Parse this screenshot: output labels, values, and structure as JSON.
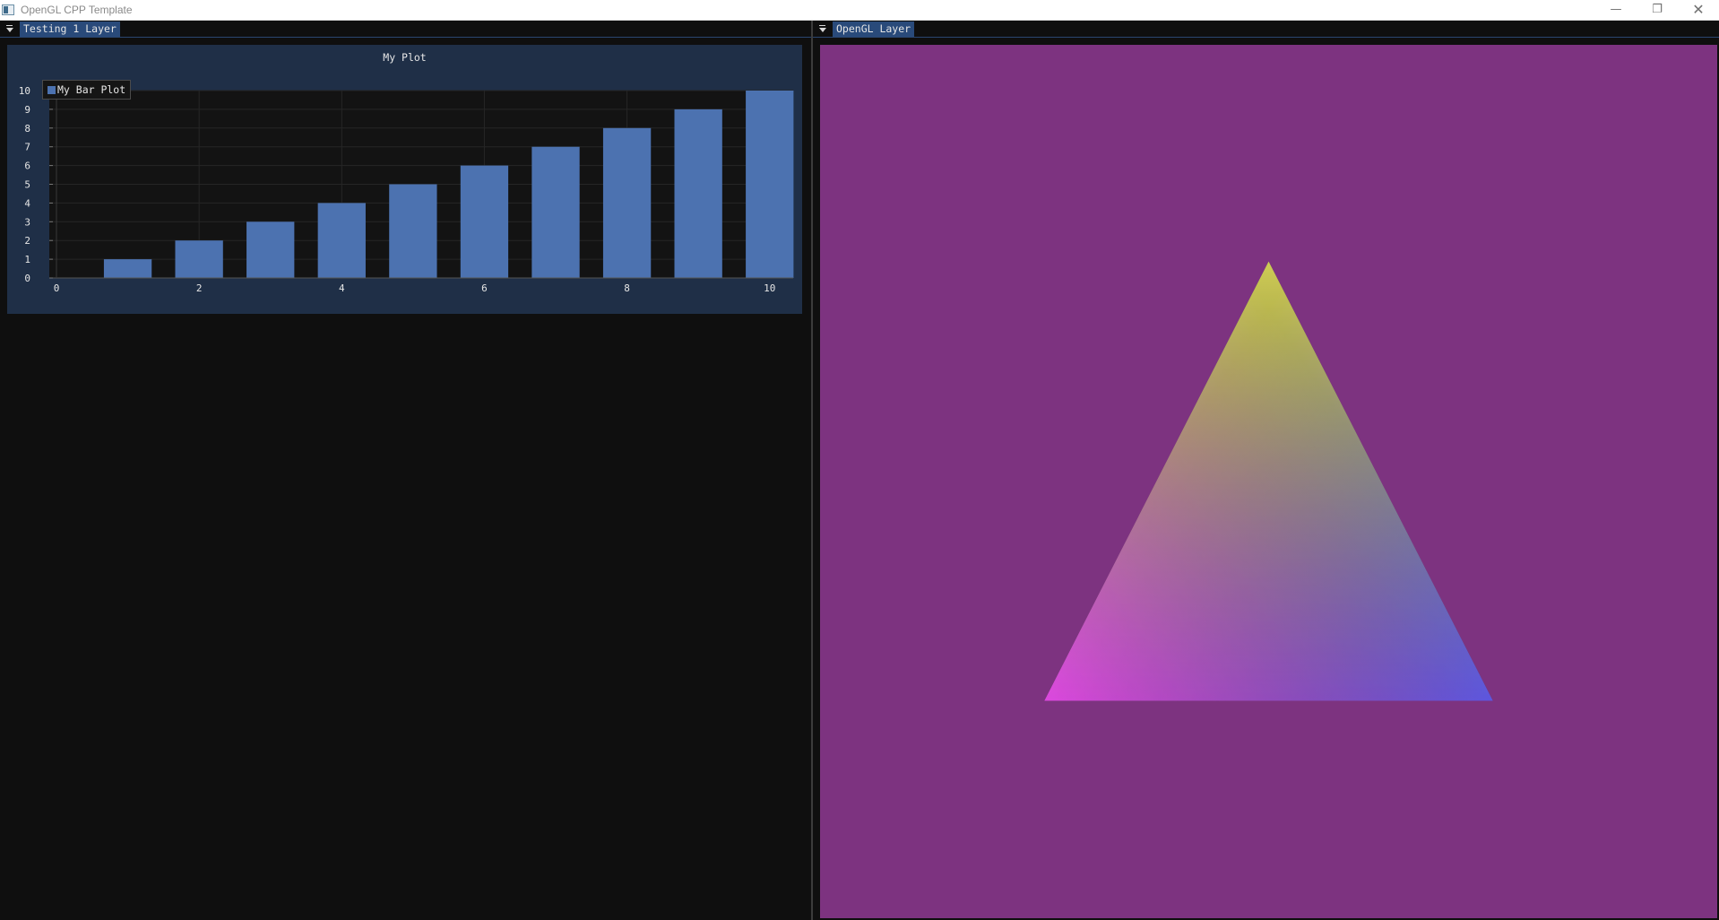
{
  "window": {
    "title": "OpenGL CPP Template",
    "controls": {
      "minimize": "—",
      "maximize": "❐",
      "close": "✕"
    }
  },
  "left_panel": {
    "tab_label": "Testing 1 Layer",
    "collapse_icon": "collapse-arrow-icon"
  },
  "right_panel": {
    "tab_label": "OpenGL Layer",
    "collapse_icon": "collapse-arrow-icon",
    "background_color": "#7d3380",
    "triangle_vertex_colors": {
      "top": "#c8c83c",
      "bottom_left": "#d838d8",
      "bottom_right": "#4048d8"
    }
  },
  "chart_data": {
    "type": "bar",
    "title": "My Plot",
    "xlabel": "",
    "ylabel": "",
    "series": [
      {
        "name": "My Bar Plot",
        "x": [
          1,
          2,
          3,
          4,
          5,
          6,
          7,
          8,
          9,
          10
        ],
        "values": [
          1,
          2,
          3,
          4,
          5,
          6,
          7,
          8,
          9,
          10
        ]
      }
    ],
    "xlim": [
      0,
      10.33
    ],
    "ylim": [
      0,
      10
    ],
    "x_ticks": [
      "0",
      "2",
      "4",
      "6",
      "8",
      "10"
    ],
    "y_ticks": [
      "0",
      "1",
      "2",
      "3",
      "4",
      "5",
      "6",
      "7",
      "8",
      "9",
      "10"
    ],
    "bar_color": "#4c72b0",
    "grid": true,
    "legend": "top-left"
  }
}
